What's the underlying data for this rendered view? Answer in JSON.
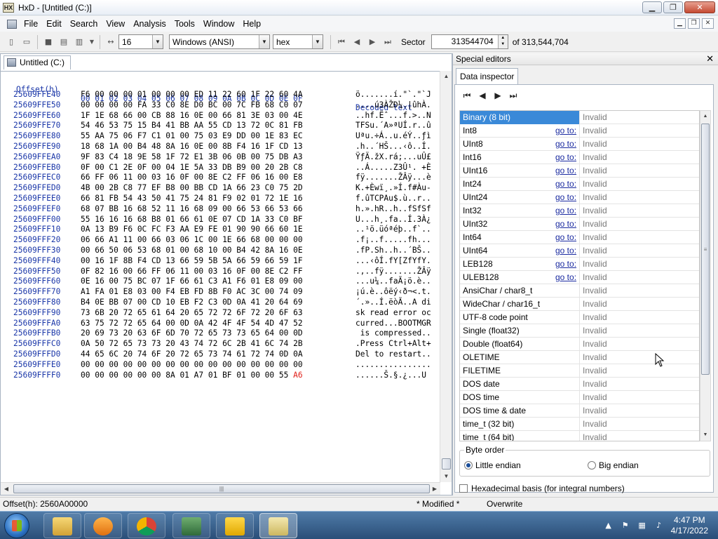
{
  "window": {
    "title": "HxD - [Untitled (C:)]"
  },
  "menu": [
    "File",
    "Edit",
    "Search",
    "View",
    "Analysis",
    "Tools",
    "Window",
    "Help"
  ],
  "toolbar": {
    "bytes_per_row": "16",
    "charset": "Windows (ANSI)",
    "offset_base": "hex",
    "sector_label": "Sector",
    "sector_value": "313544704",
    "sector_total": "of 313,544,704"
  },
  "editor": {
    "tab_label": "Untitled (C:)",
    "header": {
      "offset": "Offset(h)",
      "columns": "00 01 02 03 04 05 06 07 08 09 0A 0B 0C 0D 0E 0F",
      "decoded": "Decoded text"
    },
    "rows": [
      {
        "off": "25609FFE40",
        "hex": "F6 00 00 00 01 00 00 00 ED 11 22 60 1F 22 60 4A",
        "dec": "ö.......í.\"`.\"`J"
      },
      {
        "off": "25609FFE50",
        "hex": "00 00 00 00 FA 33 C0 8E D0 BC 00 7C FB 68 C0 07",
        "dec": "....ú3ÀŽÐ¼.|ûhÀ."
      },
      {
        "off": "25609FFE60",
        "hex": "1F 1E 68 66 00 CB 88 16 0E 00 66 81 3E 03 00 4E",
        "dec": "..hf.Ëˆ...f.>..N"
      },
      {
        "off": "25609FFE70",
        "hex": "54 46 53 75 15 B4 41 BB AA 55 CD 13 72 0C 81 FB",
        "dec": "TFSu.´A»ªUÍ.r..û"
      },
      {
        "off": "25609FFE80",
        "hex": "55 AA 75 06 F7 C1 01 00 75 03 E9 DD 00 1E 83 EC",
        "dec": "Uªu.÷Á..u.éÝ..ƒì"
      },
      {
        "off": "25609FFE90",
        "hex": "18 68 1A 00 B4 48 8A 16 0E 00 8B F4 16 1F CD 13",
        "dec": ".h..´HŠ...‹ô..Í."
      },
      {
        "off": "25609FFEA0",
        "hex": "9F 83 C4 18 9E 58 1F 72 E1 3B 06 0B 00 75 DB A3",
        "dec": "ŸƒÄ.žX.rá;...uÛ£"
      },
      {
        "off": "25609FFEB0",
        "hex": "0F 00 C1 2E 0F 00 04 1E 5A 33 DB B9 00 20 2B C8",
        "dec": "..Á.....Z3Û¹. +È"
      },
      {
        "off": "25609FFEC0",
        "hex": "66 FF 06 11 00 03 16 0F 00 8E C2 FF 06 16 00 E8",
        "dec": "fÿ.......ŽÂÿ...è"
      },
      {
        "off": "25609FFED0",
        "hex": "4B 00 2B C8 77 EF B8 00 BB CD 1A 66 23 C0 75 2D",
        "dec": "K.+Èwï¸.»Í.f#Àu-"
      },
      {
        "off": "25609FFEE0",
        "hex": "66 81 FB 54 43 50 41 75 24 81 F9 02 01 72 1E 16",
        "dec": "f.ûTCPAu$.ù..r.."
      },
      {
        "off": "25609FFEF0",
        "hex": "68 07 BB 16 68 52 11 16 68 09 00 66 53 66 53 66",
        "dec": "h.».hR..h..fSfSf"
      },
      {
        "off": "25609FFF00",
        "hex": "55 16 16 16 68 B8 01 66 61 0E 07 CD 1A 33 C0 BF",
        "dec": "U...h¸.fa..Í.3À¿"
      },
      {
        "off": "25609FFF10",
        "hex": "0A 13 B9 F6 0C FC F3 AA E9 FE 01 90 90 66 60 1E",
        "dec": "..¹ö.üóªéþ..f`.."
      },
      {
        "off": "25609FFF20",
        "hex": "06 66 A1 11 00 66 03 06 1C 00 1E 66 68 00 00 00",
        "dec": ".f¡..f.....fh..."
      },
      {
        "off": "25609FFF30",
        "hex": "00 66 50 06 53 68 01 00 68 10 00 B4 42 8A 16 0E",
        "dec": ".fP.Sh..h..´BŠ.."
      },
      {
        "off": "25609FFF40",
        "hex": "00 16 1F 8B F4 CD 13 66 59 5B 5A 66 59 66 59 1F",
        "dec": "...‹ôÍ.fY[ZfYfY."
      },
      {
        "off": "25609FFF50",
        "hex": "0F 82 16 00 66 FF 06 11 00 03 16 0F 00 8E C2 FF",
        "dec": ".‚..fÿ.......ŽÂÿ"
      },
      {
        "off": "25609FFF60",
        "hex": "0E 16 00 75 BC 07 1F 66 61 C3 A1 F6 01 E8 09 00",
        "dec": "...u¼..faÃ¡ö.è.."
      },
      {
        "off": "25609FFF70",
        "hex": "A1 FA 01 E8 03 00 F4 EB FD 8B F0 AC 3C 00 74 09",
        "dec": "¡ú.è..ôëý‹ð¬<.t."
      },
      {
        "off": "25609FFF80",
        "hex": "B4 0E BB 07 00 CD 10 EB F2 C3 0D 0A 41 20 64 69",
        "dec": "´.»..Í.ëòÃ..A di"
      },
      {
        "off": "25609FFF90",
        "hex": "73 6B 20 72 65 61 64 20 65 72 72 6F 72 20 6F 63",
        "dec": "sk read error oc"
      },
      {
        "off": "25609FFFA0",
        "hex": "63 75 72 72 65 64 00 0D 0A 42 4F 4F 54 4D 47 52",
        "dec": "curred...BOOTMGR"
      },
      {
        "off": "25609FFFB0",
        "hex": "20 69 73 20 63 6F 6D 70 72 65 73 73 65 64 00 0D",
        "dec": " is compressed.."
      },
      {
        "off": "25609FFFC0",
        "hex": "0A 50 72 65 73 73 20 43 74 72 6C 2B 41 6C 74 2B",
        "dec": ".Press Ctrl+Alt+"
      },
      {
        "off": "25609FFFD0",
        "hex": "44 65 6C 20 74 6F 20 72 65 73 74 61 72 74 0D 0A",
        "dec": "Del to restart.."
      },
      {
        "off": "25609FFFE0",
        "hex": "00 00 00 00 00 00 00 00 00 00 00 00 00 00 00 00",
        "dec": "................"
      },
      {
        "off": "25609FFFF0",
        "hex": "00 00 00 00 00 00 8A 01 A7 01 BF 01 00 00 55",
        "last": "A6",
        "dec": "......Š.§.¿...U"
      }
    ]
  },
  "special": {
    "title": "Special editors",
    "tab": "Data inspector",
    "goto_label": "go to:",
    "rows": [
      {
        "name": "Binary (8 bit)",
        "goto": false,
        "value": "Invalid"
      },
      {
        "name": "Int8",
        "goto": true,
        "value": "Invalid"
      },
      {
        "name": "UInt8",
        "goto": true,
        "value": "Invalid"
      },
      {
        "name": "Int16",
        "goto": true,
        "value": "Invalid"
      },
      {
        "name": "UInt16",
        "goto": true,
        "value": "Invalid"
      },
      {
        "name": "Int24",
        "goto": true,
        "value": "Invalid"
      },
      {
        "name": "UInt24",
        "goto": true,
        "value": "Invalid"
      },
      {
        "name": "Int32",
        "goto": true,
        "value": "Invalid"
      },
      {
        "name": "UInt32",
        "goto": true,
        "value": "Invalid"
      },
      {
        "name": "Int64",
        "goto": true,
        "value": "Invalid"
      },
      {
        "name": "UInt64",
        "goto": true,
        "value": "Invalid"
      },
      {
        "name": "LEB128",
        "goto": true,
        "value": "Invalid"
      },
      {
        "name": "ULEB128",
        "goto": true,
        "value": "Invalid"
      },
      {
        "name": "AnsiChar / char8_t",
        "goto": false,
        "value": "Invalid"
      },
      {
        "name": "WideChar / char16_t",
        "goto": false,
        "value": "Invalid"
      },
      {
        "name": "UTF-8 code point",
        "goto": false,
        "value": "Invalid"
      },
      {
        "name": "Single (float32)",
        "goto": false,
        "value": "Invalid"
      },
      {
        "name": "Double (float64)",
        "goto": false,
        "value": "Invalid"
      },
      {
        "name": "OLETIME",
        "goto": false,
        "value": "Invalid"
      },
      {
        "name": "FILETIME",
        "goto": false,
        "value": "Invalid"
      },
      {
        "name": "DOS date",
        "goto": false,
        "value": "Invalid"
      },
      {
        "name": "DOS time",
        "goto": false,
        "value": "Invalid"
      },
      {
        "name": "DOS time & date",
        "goto": false,
        "value": "Invalid"
      },
      {
        "name": "time_t (32 bit)",
        "goto": false,
        "value": "Invalid"
      },
      {
        "name": "time_t (64 bit)",
        "goto": false,
        "value": "Invalid"
      }
    ],
    "byte_order": {
      "label": "Byte order",
      "little": "Little endian",
      "big": "Big endian"
    },
    "hex_basis": "Hexadecimal basis (for integral numbers)"
  },
  "status": {
    "offset": "Offset(h): 2560A00000",
    "modified": "* Modified *",
    "mode": "Overwrite"
  },
  "taskbar": {
    "time": "4:47 PM",
    "date": "4/17/2022"
  },
  "colors": {
    "offset_blue": "#1a36a8",
    "selected_byte_red": "#e0201a",
    "selection_blue": "#3a89d8"
  }
}
